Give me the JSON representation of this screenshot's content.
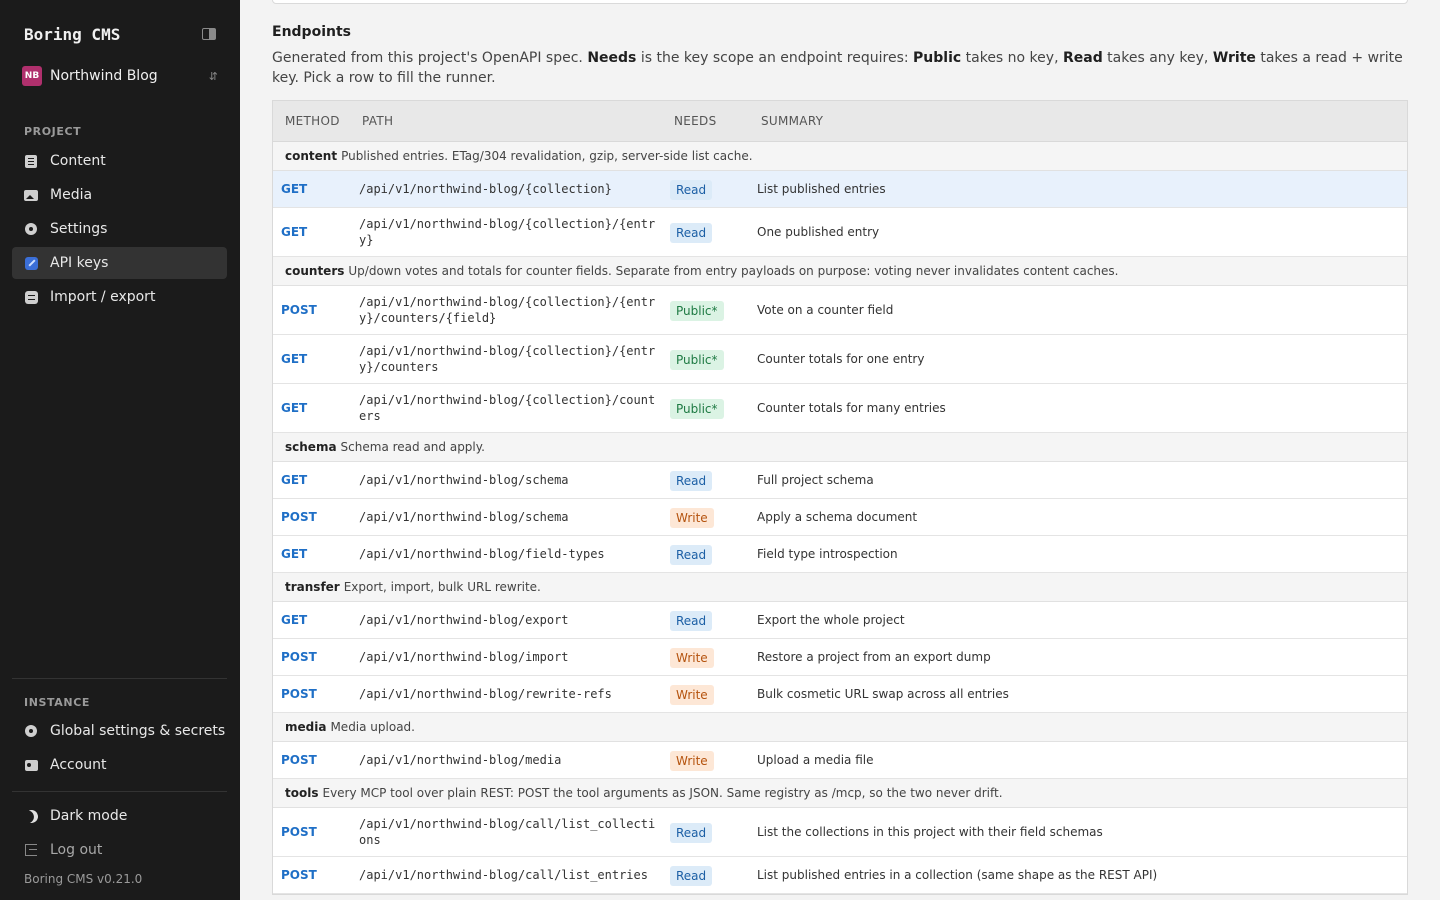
{
  "sidebar": {
    "brand": "Boring CMS",
    "project": {
      "initials": "NB",
      "name": "Northwind Blog"
    },
    "project_section_label": "PROJECT",
    "project_items": [
      {
        "label": "Content",
        "icon": "content-icon"
      },
      {
        "label": "Media",
        "icon": "media-icon"
      },
      {
        "label": "Settings",
        "icon": "gear-icon"
      },
      {
        "label": "API keys",
        "icon": "key-icon",
        "active": true
      },
      {
        "label": "Import / export",
        "icon": "import-export-icon"
      }
    ],
    "instance_section_label": "INSTANCE",
    "instance_items": [
      {
        "label": "Global settings & secrets",
        "icon": "gear-icon"
      },
      {
        "label": "Account",
        "icon": "account-icon"
      }
    ],
    "dark_mode_label": "Dark mode",
    "logout_label": "Log out",
    "version": "Boring CMS v0.21.0"
  },
  "endpoints": {
    "title": "Endpoints",
    "desc_parts": {
      "p1": "Generated from this project's OpenAPI spec. ",
      "needs": "Needs",
      "p2": " is the key scope an endpoint requires: ",
      "public": "Public",
      "p3": " takes no key, ",
      "read": "Read",
      "p4": " takes any key, ",
      "write": "Write",
      "p5": " takes a read + write key. Pick a row to fill the runner."
    },
    "columns": {
      "method": "METHOD",
      "path": "PATH",
      "needs": "NEEDS",
      "summary": "SUMMARY"
    },
    "colors": {
      "read": "#1c5fa5",
      "write": "#b5530e",
      "public": "#1e7a43",
      "method": "#1f6fc6",
      "selected_row": "#e8f1fc"
    },
    "groups": [
      {
        "name": "content",
        "description": "Published entries. ETag/304 revalidation, gzip, server-side list cache.",
        "rows": [
          {
            "method": "GET",
            "path": "/api/v1/northwind-blog/{collection}",
            "needs": "Read",
            "summary": "List published entries",
            "selected": true,
            "tall": false
          },
          {
            "method": "GET",
            "path": "/api/v1/northwind-blog/{collection}/{entry}",
            "needs": "Read",
            "summary": "One published entry",
            "tall": true
          }
        ]
      },
      {
        "name": "counters",
        "description": "Up/down votes and totals for counter fields. Separate from entry payloads on purpose: voting never invalidates content caches.",
        "rows": [
          {
            "method": "POST",
            "path": "/api/v1/northwind-blog/{collection}/{entry}/counters/{field}",
            "needs": "Public*",
            "summary": "Vote on a counter field",
            "tall": true
          },
          {
            "method": "GET",
            "path": "/api/v1/northwind-blog/{collection}/{entry}/counters",
            "needs": "Public*",
            "summary": "Counter totals for one entry",
            "tall": true
          },
          {
            "method": "GET",
            "path": "/api/v1/northwind-blog/{collection}/counters",
            "needs": "Public*",
            "summary": "Counter totals for many entries",
            "tall": true
          }
        ]
      },
      {
        "name": "schema",
        "description": "Schema read and apply.",
        "rows": [
          {
            "method": "GET",
            "path": "/api/v1/northwind-blog/schema",
            "needs": "Read",
            "summary": "Full project schema",
            "tall": false
          },
          {
            "method": "POST",
            "path": "/api/v1/northwind-blog/schema",
            "needs": "Write",
            "summary": "Apply a schema document",
            "tall": false
          },
          {
            "method": "GET",
            "path": "/api/v1/northwind-blog/field-types",
            "needs": "Read",
            "summary": "Field type introspection",
            "tall": false
          }
        ]
      },
      {
        "name": "transfer",
        "description": "Export, import, bulk URL rewrite.",
        "rows": [
          {
            "method": "GET",
            "path": "/api/v1/northwind-blog/export",
            "needs": "Read",
            "summary": "Export the whole project",
            "tall": false
          },
          {
            "method": "POST",
            "path": "/api/v1/northwind-blog/import",
            "needs": "Write",
            "summary": "Restore a project from an export dump",
            "tall": false
          },
          {
            "method": "POST",
            "path": "/api/v1/northwind-blog/rewrite-refs",
            "needs": "Write",
            "summary": "Bulk cosmetic URL swap across all entries",
            "tall": false
          }
        ]
      },
      {
        "name": "media",
        "description": "Media upload.",
        "rows": [
          {
            "method": "POST",
            "path": "/api/v1/northwind-blog/media",
            "needs": "Write",
            "summary": "Upload a media file",
            "tall": false
          }
        ]
      },
      {
        "name": "tools",
        "description": "Every MCP tool over plain REST: POST the tool arguments as JSON. Same registry as /mcp, so the two never drift.",
        "rows": [
          {
            "method": "POST",
            "path": "/api/v1/northwind-blog/call/list_collections",
            "needs": "Read",
            "summary": "List the collections in this project with their field schemas",
            "tall": true
          },
          {
            "method": "POST",
            "path": "/api/v1/northwind-blog/call/list_entries",
            "needs": "Read",
            "summary": "List published entries in a collection (same shape as the REST API)",
            "tall": false
          }
        ]
      }
    ]
  }
}
